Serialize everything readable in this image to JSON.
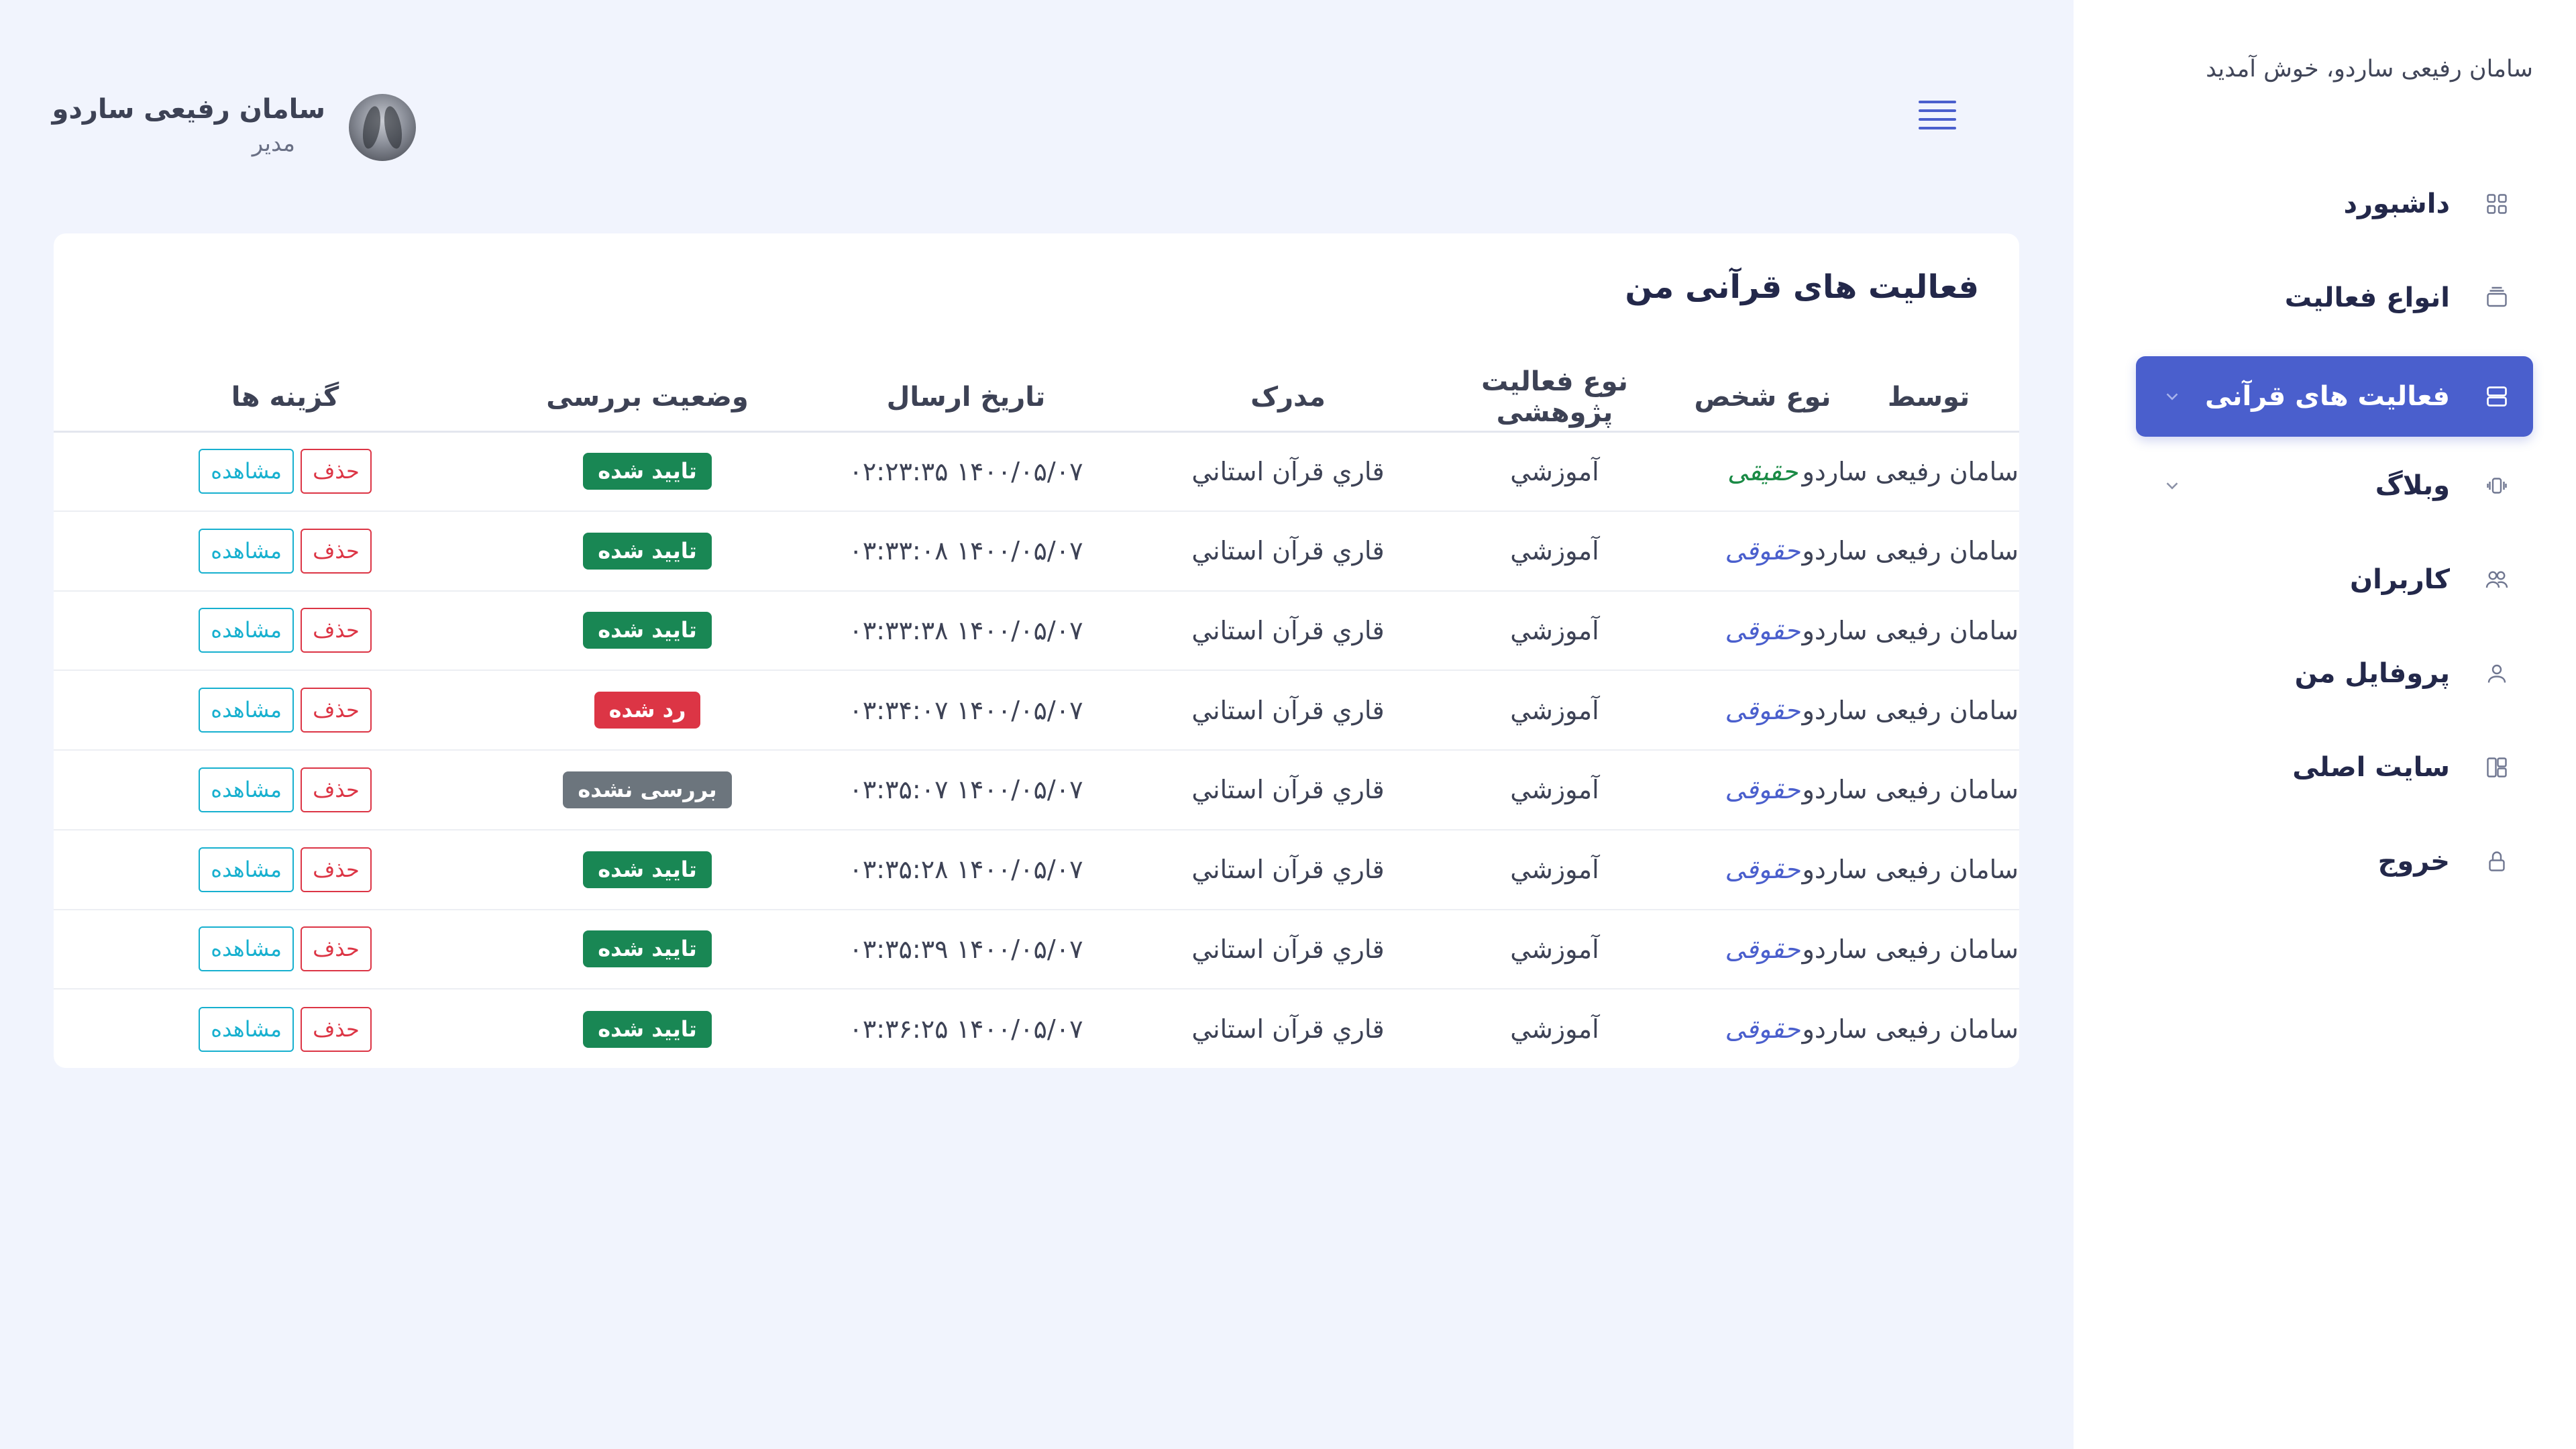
{
  "sidebar": {
    "welcome": "سامان رفیعی ساردو، خوش آمدید",
    "items": [
      {
        "label": "داشبورد",
        "icon": "grid-icon"
      },
      {
        "label": "انواع فعالیت",
        "icon": "layers-icon"
      },
      {
        "label": "فعالیت های قرآنی",
        "icon": "server-icon",
        "active": true
      },
      {
        "label": "وبلاگ",
        "icon": "broadcast-icon"
      },
      {
        "label": "کاربران",
        "icon": "users-icon"
      },
      {
        "label": "پروفایل من",
        "icon": "user-icon"
      },
      {
        "label": "سایت اصلی",
        "icon": "layout-icon"
      },
      {
        "label": "خروج",
        "icon": "lock-icon"
      }
    ]
  },
  "header": {
    "user_name": "سامان رفیعی ساردو",
    "user_role": "مدیر"
  },
  "card": {
    "title": "فعالیت های قرآنی من",
    "columns": [
      "توسط",
      "نوع شخص",
      "نوع فعالیت پژوهشی",
      "مدرک",
      "تاریخ ارسال",
      "وضعیت بررسی",
      "گزینه ها"
    ],
    "delete_label": "حذف",
    "view_label": "مشاهده",
    "rows": [
      {
        "by": "سامان رفیعی ساردو",
        "person_type": "حقیقی",
        "activity_type": "آموزشي",
        "document": "قاري قرآن استاني",
        "date": "۱۴۰۰/۰۵/۰۷ ۰۲:۲۳:۳۵",
        "status": "تایید شده"
      },
      {
        "by": "سامان رفیعی ساردو",
        "person_type": "حقوقی",
        "activity_type": "آموزشي",
        "document": "قاري قرآن استاني",
        "date": "۱۴۰۰/۰۵/۰۷ ۰۳:۳۳:۰۸",
        "status": "تایید شده"
      },
      {
        "by": "سامان رفیعی ساردو",
        "person_type": "حقوقی",
        "activity_type": "آموزشي",
        "document": "قاري قرآن استاني",
        "date": "۱۴۰۰/۰۵/۰۷ ۰۳:۳۳:۳۸",
        "status": "تایید شده"
      },
      {
        "by": "سامان رفیعی ساردو",
        "person_type": "حقوقی",
        "activity_type": "آموزشي",
        "document": "قاري قرآن استاني",
        "date": "۱۴۰۰/۰۵/۰۷ ۰۳:۳۴:۰۷",
        "status": "رد شده"
      },
      {
        "by": "سامان رفیعی ساردو",
        "person_type": "حقوقی",
        "activity_type": "آموزشي",
        "document": "قاري قرآن استاني",
        "date": "۱۴۰۰/۰۵/۰۷ ۰۳:۳۵:۰۷",
        "status": "بررسی نشده"
      },
      {
        "by": "سامان رفیعی ساردو",
        "person_type": "حقوقی",
        "activity_type": "آموزشي",
        "document": "قاري قرآن استاني",
        "date": "۱۴۰۰/۰۵/۰۷ ۰۳:۳۵:۲۸",
        "status": "تایید شده"
      },
      {
        "by": "سامان رفیعی ساردو",
        "person_type": "حقوقی",
        "activity_type": "آموزشي",
        "document": "قاري قرآن استاني",
        "date": "۱۴۰۰/۰۵/۰۷ ۰۳:۳۵:۳۹",
        "status": "تایید شده"
      },
      {
        "by": "سامان رفیعی ساردو",
        "person_type": "حقوقی",
        "activity_type": "آموزشي",
        "document": "قاري قرآن استاني",
        "date": "۱۴۰۰/۰۵/۰۷ ۰۳:۳۶:۲۵",
        "status": "تایید شده"
      }
    ]
  },
  "colors": {
    "accent": "#4a5fcd",
    "approved": "#198754",
    "rejected": "#dc3545",
    "pending": "#6c757d",
    "view": "#17b0cf",
    "background": "#f1f4fd"
  }
}
